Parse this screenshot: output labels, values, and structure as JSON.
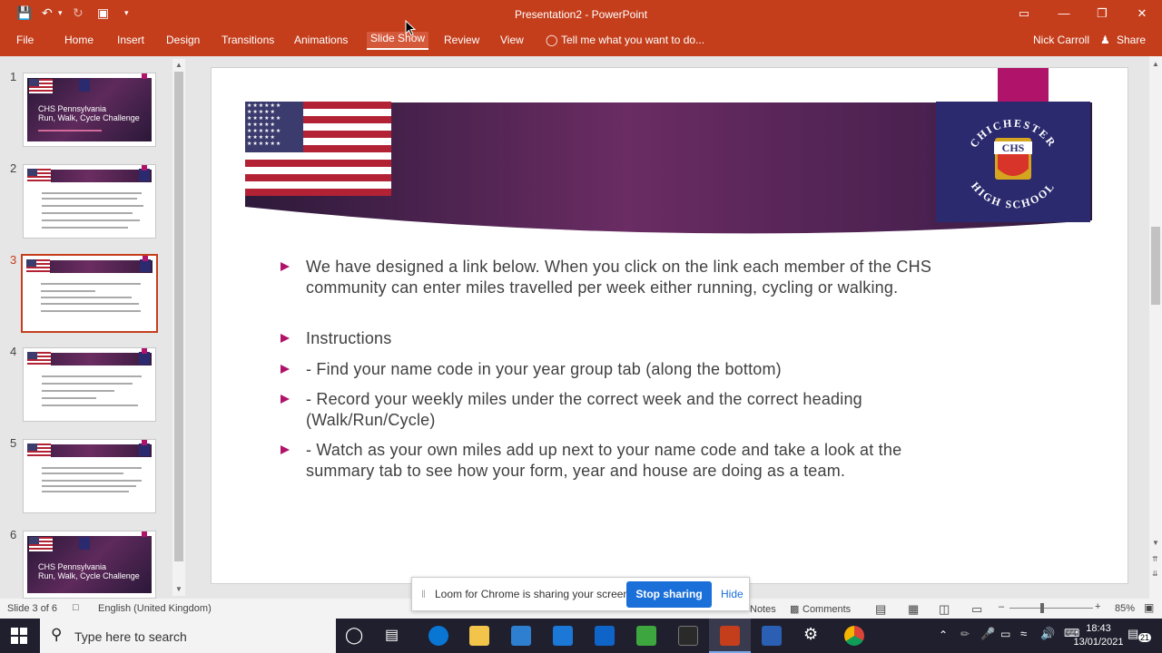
{
  "app": {
    "title": "Presentation2 - PowerPoint",
    "user": "Nick Carroll",
    "share_label": "Share"
  },
  "ribbon": {
    "file": "File",
    "tabs": [
      "Home",
      "Insert",
      "Design",
      "Transitions",
      "Animations",
      "Slide Show",
      "Review",
      "View"
    ],
    "active_tab": "Slide Show",
    "tell_me": "Tell me what you want to do..."
  },
  "thumbnails": [
    {
      "num": "1",
      "title_line1": "CHS Pennsylvania",
      "title_line2": "Run, Walk, Cycle Challenge"
    },
    {
      "num": "2"
    },
    {
      "num": "3",
      "selected": true
    },
    {
      "num": "4"
    },
    {
      "num": "5"
    },
    {
      "num": "6",
      "title_line1": "CHS Pennsylvania",
      "title_line2": "Run, Walk, Cycle Challenge"
    }
  ],
  "slide": {
    "logo_top": "CHICHESTER",
    "logo_mid": "CHS",
    "logo_bottom": "HIGH SCHOOL",
    "bullets": [
      "We have designed a link below. When you click on the link each member of the CHS community can enter miles travelled per week either running, cycling or walking.",
      "Instructions",
      "- Find your name code in your year group tab (along the bottom)",
      "- Record your weekly miles under the correct week and the correct heading (Walk/Run/Cycle)",
      "- Watch as your own miles add up next to your name code and take a look at the summary tab to see how your form, year and house are doing as a team."
    ]
  },
  "loom": {
    "message": "Loom for Chrome is sharing your screen.",
    "stop_label": "Stop sharing",
    "hide_label": "Hide"
  },
  "status": {
    "slide_info": "Slide 3 of 6",
    "language": "English (United Kingdom)",
    "notes": "Notes",
    "comments": "Comments",
    "zoom": "85%"
  },
  "taskbar": {
    "search_placeholder": "Type here to search",
    "time": "18:43",
    "date": "13/01/2021",
    "notifications": "21"
  },
  "colors": {
    "accent": "#c43e1c",
    "bullet": "#b0136a",
    "banner_purple": "#5e2a5c",
    "logo_navy": "#2b2a6e",
    "loom_blue": "#1a6fd8"
  }
}
